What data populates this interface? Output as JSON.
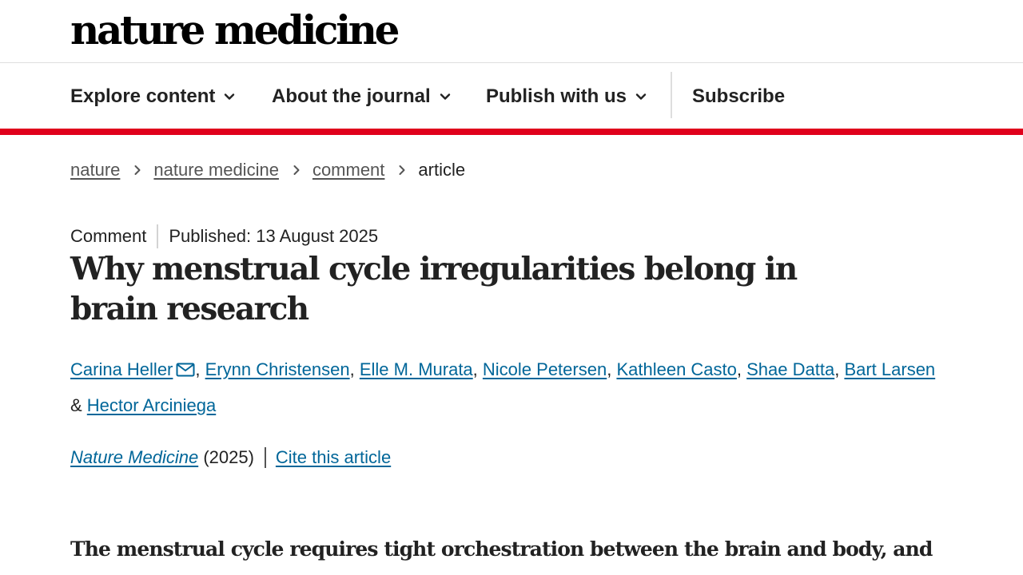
{
  "header": {
    "logo_text": "nature medicine"
  },
  "nav": {
    "items": [
      {
        "label": "Explore content",
        "icon": "chevron-down-icon"
      },
      {
        "label": "About the journal",
        "icon": "chevron-down-icon"
      },
      {
        "label": "Publish with us",
        "icon": "chevron-down-icon"
      }
    ],
    "subscribe_label": "Subscribe",
    "accent_color": "#e0001b"
  },
  "breadcrumb": {
    "links": [
      "nature",
      "nature medicine",
      "comment"
    ],
    "current": "article"
  },
  "article": {
    "type": "Comment",
    "published": "Published: 13 August 2025",
    "title": "Why menstrual cycle irregularities belong in brain research",
    "authors": [
      "Carina Heller",
      "Erynn Christensen",
      "Elle M. Murata",
      "Nicole Petersen",
      "Kathleen Casto",
      "Shae Datta",
      "Bart Larsen",
      "Hector Arciniega"
    ],
    "author_separator": ", ",
    "last_author_joiner": "& ",
    "journal": "Nature Medicine",
    "year": "(2025)",
    "cite_label": "Cite this article",
    "lead": "The menstrual cycle requires tight orchestration between the brain and body, and",
    "link_color": "#006699"
  }
}
